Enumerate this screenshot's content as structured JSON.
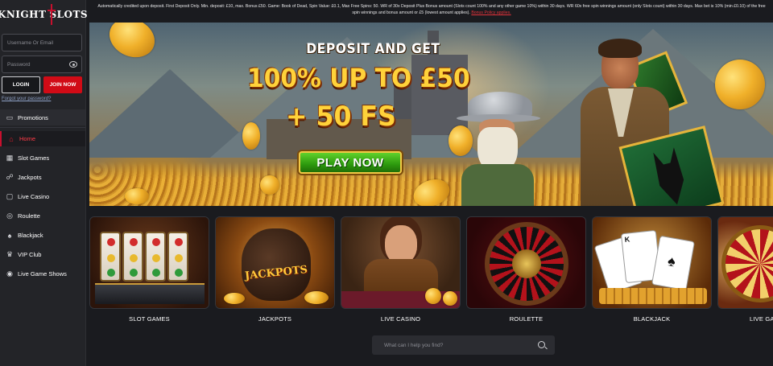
{
  "brand": {
    "logo_left": "KNIGHT",
    "logo_right": "SLOTS"
  },
  "notice": {
    "text": "Automatically credited upon deposit. First Deposit Only. Min. deposit: £10, max. Bonus £50. Game: Book of Dead, Spin Value: £0.1, Max Free Spins: 50. WR of 30x Deposit Plus Bonus amount (Slots count 100% and any other game 10%) within 30 days. WR 60x free spin winnings amount (only Slots count) within 30 days. Max bet is 10% (min £0.10) of the free spin winnings and bonus amount or £5 (lowest amount applies).",
    "link": "Bonus Policy applies."
  },
  "auth": {
    "username_placeholder": "Username Or Email",
    "password_placeholder": "Password",
    "login_label": "LOGIN",
    "join_label": "JOIN NOW",
    "forgot_label": "Forgot your password?"
  },
  "sidebar": {
    "promotions": "Promotions",
    "items": [
      {
        "label": "Home",
        "icon": "home-icon",
        "active": true
      },
      {
        "label": "Slot Games",
        "icon": "slot-machine-icon"
      },
      {
        "label": "Jackpots",
        "icon": "trophy-icon"
      },
      {
        "label": "Live Casino",
        "icon": "live-icon"
      },
      {
        "label": "Roulette",
        "icon": "roulette-icon"
      },
      {
        "label": "Blackjack",
        "icon": "cards-icon"
      },
      {
        "label": "VIP Club",
        "icon": "crown-icon"
      },
      {
        "label": "Live Game Shows",
        "icon": "game-show-icon"
      }
    ]
  },
  "banner": {
    "line1": "DEPOSIT AND GET",
    "line2": "100% UP TO £50",
    "line3": "+ 50 FS",
    "cta": "PLAY NOW"
  },
  "categories": [
    {
      "label": "SLOT GAMES"
    },
    {
      "label": "JACKPOTS"
    },
    {
      "label": "LIVE CASINO"
    },
    {
      "label": "ROULETTE"
    },
    {
      "label": "BLACKJACK"
    },
    {
      "label": "LIVE GAME SHOWS"
    }
  ],
  "tile_art_text": {
    "jackpot_bag": "JACKPOTS"
  },
  "search": {
    "placeholder": "What can I help you find?"
  },
  "colors": {
    "accent_red": "#d10b16",
    "bg": "#1a1b1f",
    "sidebar_bg": "#232428",
    "cta_green": "#2d9a0e",
    "gold": "#ffd23a"
  }
}
